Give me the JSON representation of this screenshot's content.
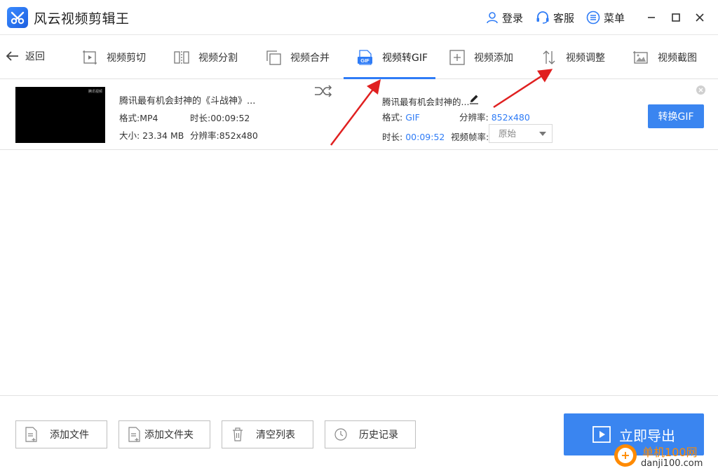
{
  "app": {
    "title": "风云视频剪辑王",
    "login_label": "登录",
    "service_label": "客服",
    "menu_label": "菜单"
  },
  "toolbar": {
    "back_label": "返回",
    "tabs": [
      {
        "label": "视频剪切",
        "icon": "video-cut-icon"
      },
      {
        "label": "视频分割",
        "icon": "video-split-icon"
      },
      {
        "label": "视频合并",
        "icon": "video-merge-icon"
      },
      {
        "label": "视频转GIF",
        "icon": "gif-icon",
        "active": true
      },
      {
        "label": "视频添加",
        "icon": "video-add-icon"
      },
      {
        "label": "视频调整",
        "icon": "video-adjust-icon"
      },
      {
        "label": "视频截图",
        "icon": "video-screenshot-icon"
      }
    ],
    "gif_icon_text": "GIF"
  },
  "file": {
    "thumb_watermark": "腾讯视频",
    "source": {
      "name": "腾讯最有机会封神的《斗战神》...",
      "format": "格式:MP4",
      "duration": "时长:00:09:52",
      "size": "大小: 23.34 MB",
      "resolution": "分辨率:852x480"
    },
    "output": {
      "name": "腾讯最有机会封神的...",
      "format_label": "格式:",
      "format_value": "GIF",
      "resolution_label": "分辨率:",
      "resolution_value": "852x480",
      "duration_label": "时长:",
      "duration_value": "00:09:52",
      "fps_label": "视频帧率:",
      "fps_value": "原始"
    },
    "convert_label": "转换GIF"
  },
  "bottom": {
    "add_file": "添加文件",
    "add_folder": "添加文件夹",
    "clear_list": "清空列表",
    "history": "历史记录",
    "export": "立即导出"
  },
  "watermark": {
    "site_cn": "单机100网",
    "site_url": "danji100.com"
  },
  "colors": {
    "accent": "#3a85f0",
    "tab_underline": "#2f7cf6",
    "annotation_arrow": "#e02020",
    "watermark_orange": "#ff8a00"
  }
}
